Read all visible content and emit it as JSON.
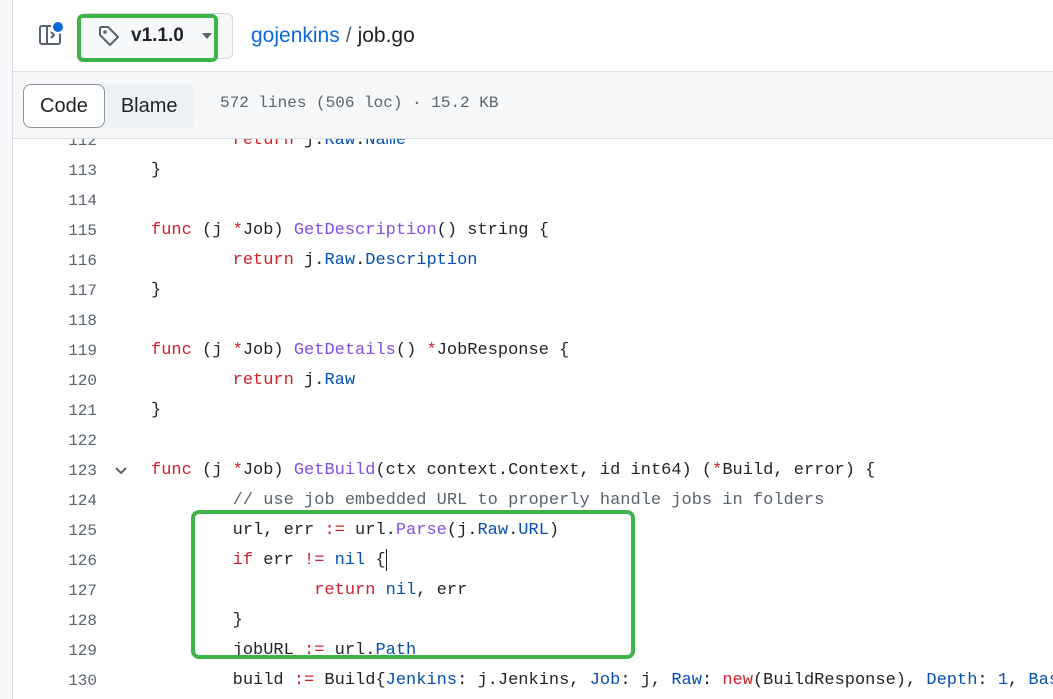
{
  "header": {
    "tag_label": "v1.1.0",
    "repo": "gojenkins",
    "separator": "/",
    "file": "job.go"
  },
  "toolbar": {
    "code_label": "Code",
    "blame_label": "Blame",
    "file_meta": "572 lines (506 loc) · 15.2 KB"
  },
  "colors": {
    "highlight": "#3db34a",
    "link": "#0969da",
    "keyword": "#cf222e",
    "function": "#8250df",
    "property": "#0550ae",
    "comment": "#59636e"
  },
  "code": {
    "lines": [
      {
        "num": "112",
        "tokens": [
          {
            "t": "        ",
            "k": "txt"
          },
          {
            "t": "return",
            "k": "kw"
          },
          {
            "t": " j.",
            "k": "txt"
          },
          {
            "t": "Raw",
            "k": "pr"
          },
          {
            "t": ".",
            "k": "txt"
          },
          {
            "t": "Name",
            "k": "pr"
          }
        ]
      },
      {
        "num": "113",
        "tokens": [
          {
            "t": "}",
            "k": "txt"
          }
        ]
      },
      {
        "num": "114",
        "tokens": []
      },
      {
        "num": "115",
        "tokens": [
          {
            "t": "func",
            "k": "kw"
          },
          {
            "t": " (j ",
            "k": "txt"
          },
          {
            "t": "*",
            "k": "kw"
          },
          {
            "t": "Job) ",
            "k": "txt"
          },
          {
            "t": "GetDescription",
            "k": "fn"
          },
          {
            "t": "() string {",
            "k": "txt"
          }
        ]
      },
      {
        "num": "116",
        "tokens": [
          {
            "t": "        ",
            "k": "txt"
          },
          {
            "t": "return",
            "k": "kw"
          },
          {
            "t": " j.",
            "k": "txt"
          },
          {
            "t": "Raw",
            "k": "pr"
          },
          {
            "t": ".",
            "k": "txt"
          },
          {
            "t": "Description",
            "k": "pr"
          }
        ]
      },
      {
        "num": "117",
        "tokens": [
          {
            "t": "}",
            "k": "txt"
          }
        ]
      },
      {
        "num": "118",
        "tokens": []
      },
      {
        "num": "119",
        "tokens": [
          {
            "t": "func",
            "k": "kw"
          },
          {
            "t": " (j ",
            "k": "txt"
          },
          {
            "t": "*",
            "k": "kw"
          },
          {
            "t": "Job) ",
            "k": "txt"
          },
          {
            "t": "GetDetails",
            "k": "fn"
          },
          {
            "t": "() ",
            "k": "txt"
          },
          {
            "t": "*",
            "k": "kw"
          },
          {
            "t": "JobResponse {",
            "k": "txt"
          }
        ]
      },
      {
        "num": "120",
        "tokens": [
          {
            "t": "        ",
            "k": "txt"
          },
          {
            "t": "return",
            "k": "kw"
          },
          {
            "t": " j.",
            "k": "txt"
          },
          {
            "t": "Raw",
            "k": "pr"
          }
        ]
      },
      {
        "num": "121",
        "tokens": [
          {
            "t": "}",
            "k": "txt"
          }
        ]
      },
      {
        "num": "122",
        "tokens": []
      },
      {
        "num": "123",
        "fold": true,
        "tokens": [
          {
            "t": "func",
            "k": "kw"
          },
          {
            "t": " (j ",
            "k": "txt"
          },
          {
            "t": "*",
            "k": "kw"
          },
          {
            "t": "Job) ",
            "k": "txt"
          },
          {
            "t": "GetBuild",
            "k": "fn"
          },
          {
            "t": "(ctx context.Context, id int64) (",
            "k": "txt"
          },
          {
            "t": "*",
            "k": "kw"
          },
          {
            "t": "Build, error) {",
            "k": "txt"
          }
        ]
      },
      {
        "num": "124",
        "tokens": [
          {
            "t": "        ",
            "k": "txt"
          },
          {
            "t": "// use job embedded URL to properly handle jobs in folders",
            "k": "cm"
          }
        ]
      },
      {
        "num": "125",
        "tokens": [
          {
            "t": "        url, err ",
            "k": "txt"
          },
          {
            "t": ":=",
            "k": "kw"
          },
          {
            "t": " url.",
            "k": "txt"
          },
          {
            "t": "Parse",
            "k": "fn"
          },
          {
            "t": "(j.",
            "k": "txt"
          },
          {
            "t": "Raw",
            "k": "pr"
          },
          {
            "t": ".",
            "k": "txt"
          },
          {
            "t": "URL",
            "k": "pr"
          },
          {
            "t": ")",
            "k": "txt"
          }
        ]
      },
      {
        "num": "126",
        "cursor": true,
        "tokens": [
          {
            "t": "        ",
            "k": "txt"
          },
          {
            "t": "if",
            "k": "kw"
          },
          {
            "t": " err ",
            "k": "txt"
          },
          {
            "t": "!=",
            "k": "kw"
          },
          {
            "t": " ",
            "k": "txt"
          },
          {
            "t": "nil",
            "k": "pr"
          },
          {
            "t": " {",
            "k": "txt"
          }
        ]
      },
      {
        "num": "127",
        "tokens": [
          {
            "t": "                ",
            "k": "txt"
          },
          {
            "t": "return",
            "k": "kw"
          },
          {
            "t": " ",
            "k": "txt"
          },
          {
            "t": "nil",
            "k": "pr"
          },
          {
            "t": ", err",
            "k": "txt"
          }
        ]
      },
      {
        "num": "128",
        "tokens": [
          {
            "t": "        }",
            "k": "txt"
          }
        ]
      },
      {
        "num": "129",
        "tokens": [
          {
            "t": "        jobURL ",
            "k": "txt"
          },
          {
            "t": ":=",
            "k": "kw"
          },
          {
            "t": " url.",
            "k": "txt"
          },
          {
            "t": "Path",
            "k": "pr"
          }
        ]
      },
      {
        "num": "130",
        "tokens": [
          {
            "t": "        build ",
            "k": "txt"
          },
          {
            "t": ":=",
            "k": "kw"
          },
          {
            "t": " Build{",
            "k": "txt"
          },
          {
            "t": "Jenkins",
            "k": "pr"
          },
          {
            "t": ": j.Jenkins, ",
            "k": "txt"
          },
          {
            "t": "Job",
            "k": "pr"
          },
          {
            "t": ": j, ",
            "k": "txt"
          },
          {
            "t": "Raw",
            "k": "pr"
          },
          {
            "t": ": ",
            "k": "txt"
          },
          {
            "t": "new",
            "k": "kw"
          },
          {
            "t": "(BuildResponse), ",
            "k": "txt"
          },
          {
            "t": "Depth",
            "k": "pr"
          },
          {
            "t": ": ",
            "k": "txt"
          },
          {
            "t": "1",
            "k": "pr"
          },
          {
            "t": ", ",
            "k": "txt"
          },
          {
            "t": "Base",
            "k": "pr"
          },
          {
            "t": ":",
            "k": "txt"
          }
        ]
      }
    ]
  }
}
